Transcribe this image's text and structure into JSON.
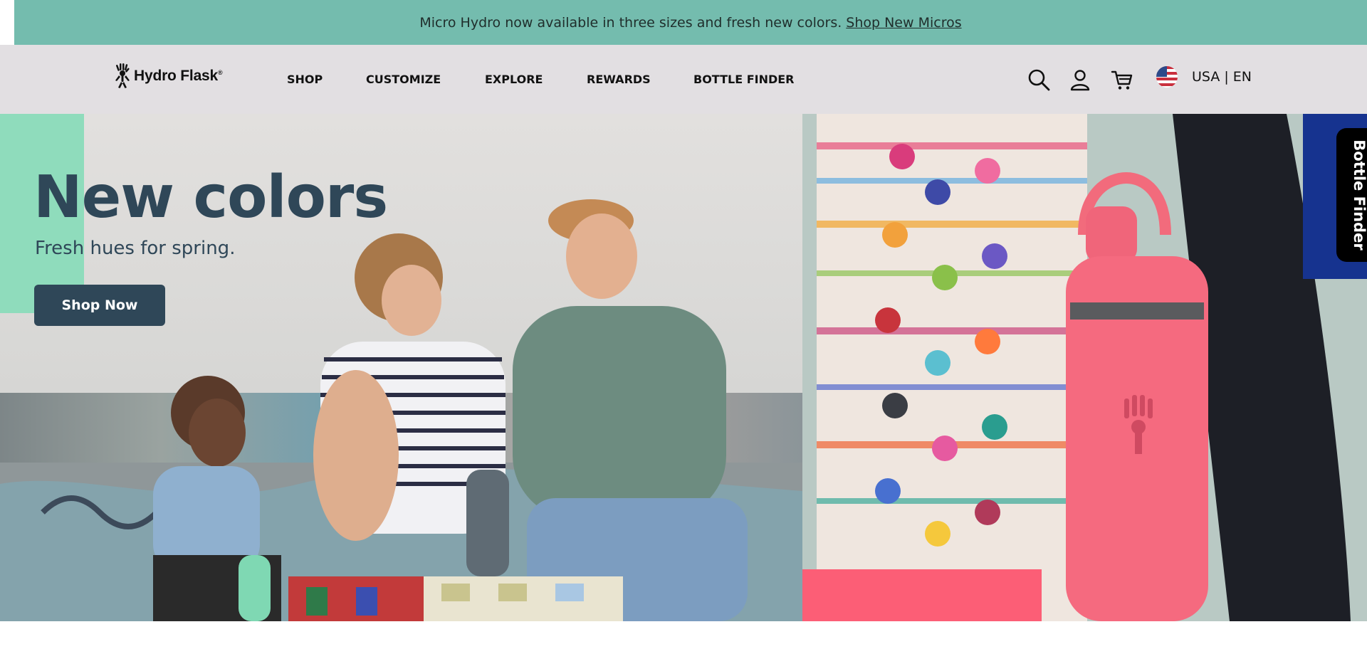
{
  "promo": {
    "text": "Micro Hydro now available in three sizes and fresh new colors.",
    "link": "Shop New Micros"
  },
  "header": {
    "logo_text": "Hydro Flask",
    "logo_mark": "®",
    "nav": [
      "SHOP",
      "CUSTOMIZE",
      "EXPLORE",
      "REWARDS",
      "BOTTLE FINDER"
    ],
    "icons": [
      "search-icon",
      "account-icon",
      "cart-icon"
    ],
    "locale": "USA | EN"
  },
  "hero": {
    "headline": "New colors",
    "subhead": "Fresh hues for spring.",
    "cta": "Shop Now"
  },
  "side_tab": {
    "label": "Bottle Finder"
  },
  "colors": {
    "promo_bg": "#74bcae",
    "header_bg": "#e2dfe2",
    "headline": "#2f4758",
    "mint_accent": "#8fdcbc",
    "pink_accent": "#fc5e76",
    "side_blue": "#16338f"
  }
}
